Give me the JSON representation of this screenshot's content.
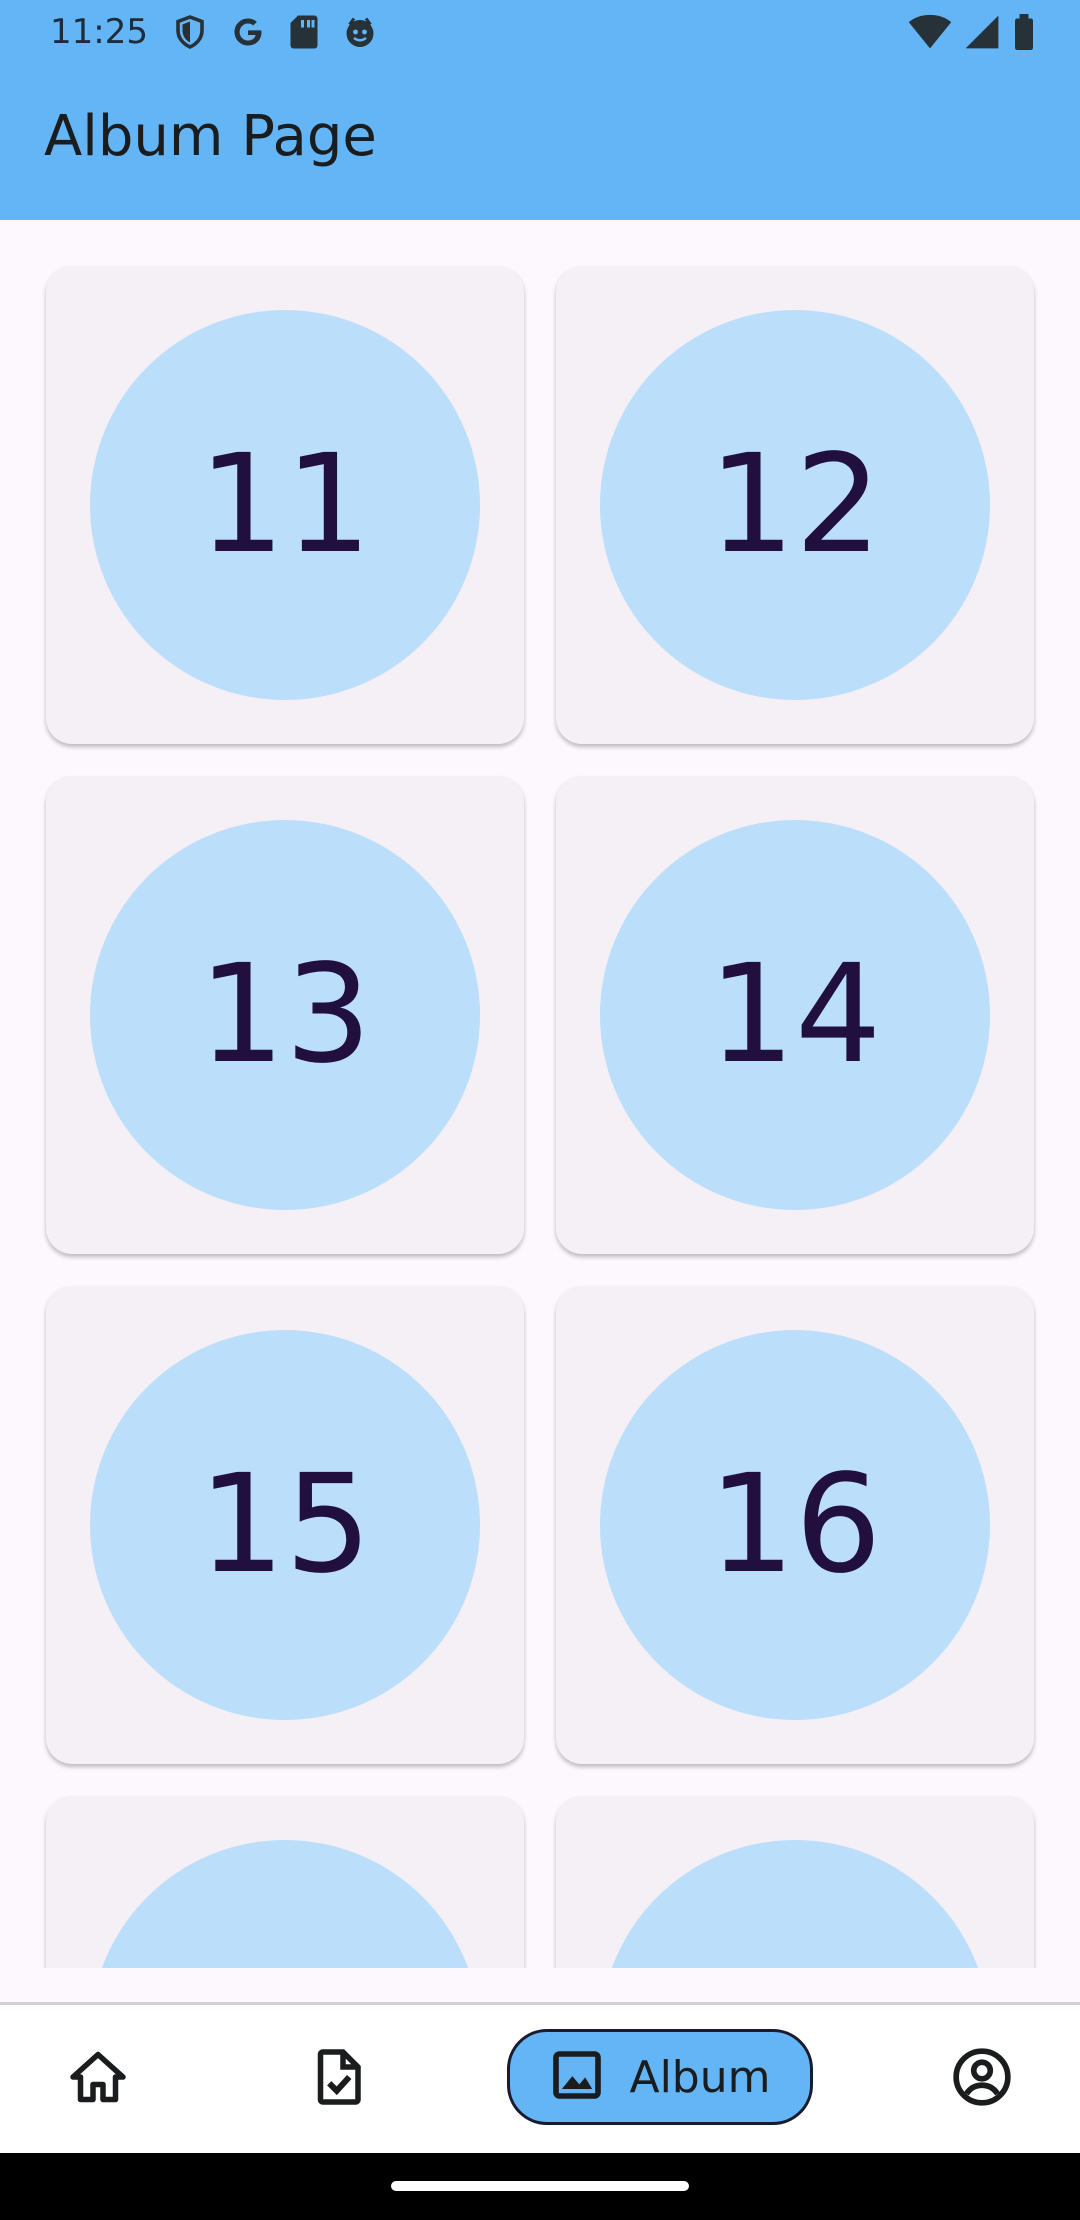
{
  "status_bar": {
    "time": "11:25",
    "left_icons": [
      "shield-icon",
      "google-icon",
      "sd-card-icon",
      "face-icon"
    ],
    "right_icons": [
      "wifi-icon",
      "signal-icon",
      "battery-icon"
    ]
  },
  "app_bar": {
    "title": "Album Page",
    "background": "#64b5f6"
  },
  "album": {
    "items": [
      {
        "number": "11"
      },
      {
        "number": "12"
      },
      {
        "number": "13"
      },
      {
        "number": "14"
      },
      {
        "number": "15"
      },
      {
        "number": "16"
      },
      {
        "number": ""
      },
      {
        "number": ""
      }
    ],
    "circle_color": "#bbdefb",
    "card_color": "#f5eff6",
    "number_color": "#21103f"
  },
  "bottom_nav": {
    "items": [
      {
        "icon": "home-icon",
        "label": ""
      },
      {
        "icon": "task-document-icon",
        "label": ""
      },
      {
        "icon": "image-icon",
        "label": "Album",
        "active": true
      },
      {
        "icon": "account-circle-icon",
        "label": ""
      }
    ],
    "active_color": "#64b5f6"
  }
}
